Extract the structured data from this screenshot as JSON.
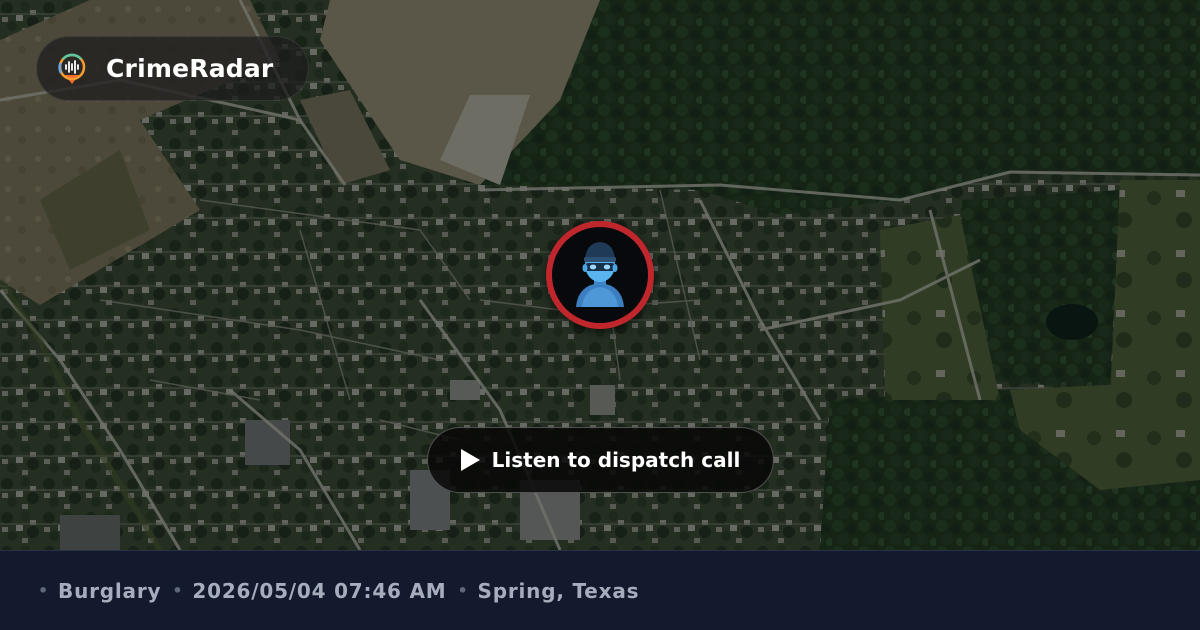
{
  "brand": {
    "name": "CrimeRadar",
    "logo_icon": "radar-pin-icon",
    "logo_colors": [
      "#f06a2a",
      "#f59b2f",
      "#5fc4a0",
      "#6aa5e6"
    ]
  },
  "marker": {
    "icon": "burglar-icon",
    "ring_color": "#c0272d",
    "figure_color": "#4fa9e8"
  },
  "dispatch_button": {
    "label": "Listen to dispatch call",
    "icon": "play-icon"
  },
  "incident": {
    "type": "Burglary",
    "datetime": "2026/05/04 07:46 AM",
    "location": "Spring, Texas"
  }
}
